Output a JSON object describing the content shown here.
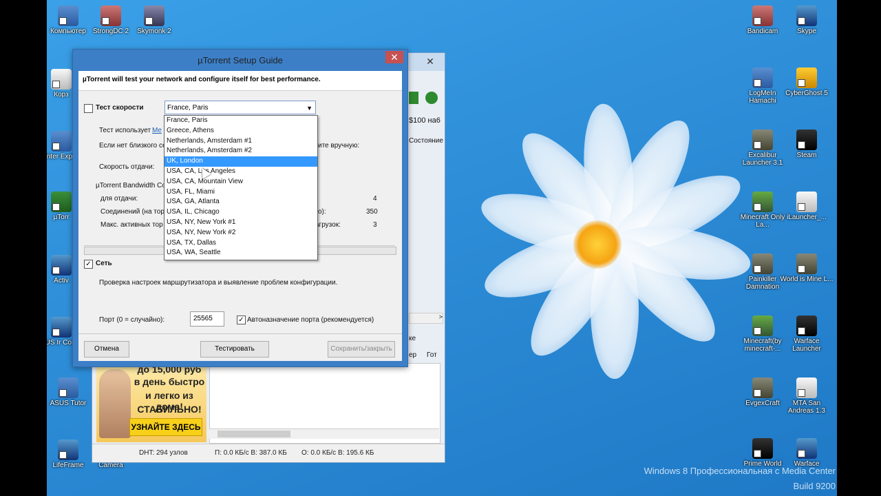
{
  "desktop": {
    "icons_left": [
      {
        "label": "Компьютер"
      },
      {
        "label": "StrongDC 2"
      },
      {
        "label": "Skymonk 2"
      },
      {
        "label": "Корз"
      },
      {
        "label": "Inter Explo"
      },
      {
        "label": "µTorr"
      },
      {
        "label": "Activ"
      },
      {
        "label": "ASUS Ir Connec"
      },
      {
        "label": "ASUS Tutor"
      },
      {
        "label": "LifeFrame"
      },
      {
        "label": "Camera"
      }
    ],
    "icons_right": [
      {
        "label": "Bandicam"
      },
      {
        "label": "Skype"
      },
      {
        "label": "LogMeIn Hamachi"
      },
      {
        "label": "CyberGhost 5"
      },
      {
        "label": "Excalibur Launcher 3.1"
      },
      {
        "label": "Steam"
      },
      {
        "label": "Minecraft Only La..."
      },
      {
        "label": "iLauncher_..."
      },
      {
        "label": "Painkiller Damnation"
      },
      {
        "label": "World is Mine L..."
      },
      {
        "label": "Minecraft(by minecraft-..."
      },
      {
        "label": "Warface Launcher"
      },
      {
        "label": "EvgexCraft"
      },
      {
        "label": "MTA San Andreas 1.3"
      },
      {
        "label": "Prime World"
      },
      {
        "label": "Warface"
      }
    ],
    "watermark_line1": "Windows 8 Профессиональная с Media Center",
    "watermark_line2": "Build 9200"
  },
  "bg_window": {
    "close": "✕",
    "price_fragment": "$100 на6",
    "col_state": "Состояние",
    "col_er": "ер",
    "col_got": "Гот",
    "tab_fragment": "ке",
    "status_dht": "DHT: 294 узлов",
    "status_down": "П: 0.0 КБ/с В: 387.0 КБ",
    "status_up": "О: 0.0 КБ/с В: 195.6 КБ",
    "ad_line1": "до 15,000 руб",
    "ad_line2": "в день быстро",
    "ad_line3": "и легко из дома!",
    "ad_line4": "СТАБИЛЬНО!",
    "ad_button": "УЗНАЙТЕ ЗДЕСЬ"
  },
  "dialog": {
    "title": "µTorrent Setup Guide",
    "close": "✕",
    "banner": "µTorrent will test your network and configure itself for best performance.",
    "speed_test_label": "Тест скорости",
    "server_selected": "France, Paris",
    "uses_text": "Тест использует",
    "uses_link": "Me",
    "no_near_text": "Если нет близкого се",
    "manual_text": "ите вручную:",
    "upload_speed_label": "Скорость отдачи:",
    "bandwidth_group": "µTorrent Bandwidth Co",
    "for_upload_label": "для отдачи:",
    "for_upload_value": "4",
    "connections_label": "Соединений (на тор",
    "connections_suffix": "о):",
    "connections_value": "350",
    "max_active_label": "Макс. активных тор",
    "max_active_suffix": "агрузок:",
    "max_active_value": "3",
    "network_label": "Сеть",
    "network_desc": "Проверка настроек маршрутизатора и выявление проблем конфигурации.",
    "port_label": "Порт (0 = случайно):",
    "port_value": "25565",
    "auto_port_label": "Автоназначение порта (рекомендуется)",
    "cancel_btn": "Отмена",
    "test_btn": "Тестировать",
    "save_btn": "Сохранить/закрыть"
  },
  "dropdown": {
    "options": [
      "France, Paris",
      "Greece, Athens",
      "Netherlands, Amsterdam #1",
      "Netherlands, Amsterdam #2",
      "UK, London",
      "USA, CA, Los Angeles",
      "USA, CA, Mountain View",
      "USA, FL, Miami",
      "USA, GA,  Atlanta",
      "USA, IL, Chicago",
      "USA, NY, New York #1",
      "USA, NY, New York #2",
      "USA, TX, Dallas",
      "USA, WA, Seattle"
    ],
    "highlighted_index": 4
  }
}
